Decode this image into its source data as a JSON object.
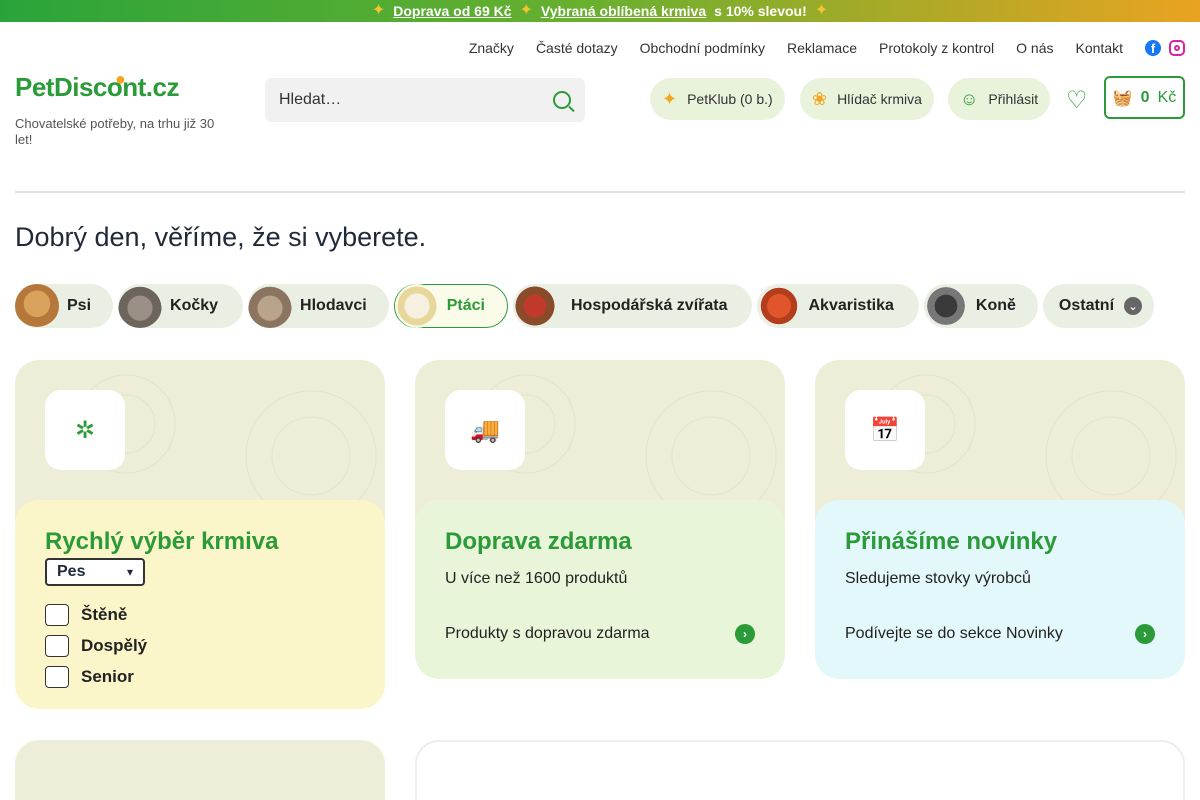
{
  "promo": {
    "part1": "Doprava od 69 Kč",
    "part2": "Vybraná oblíbená krmiva",
    "part3": "s 10% slevou!"
  },
  "topnav": [
    "Značky",
    "Časté dotazy",
    "Obchodní podmínky",
    "Reklamace",
    "Protokoly z kontrol",
    "O nás",
    "Kontakt"
  ],
  "logo": {
    "text": "PetDiscont.cz",
    "tagline": "Chovatelské potřeby, na trhu již 30 let!"
  },
  "search": {
    "placeholder": "Hledat…"
  },
  "header_buttons": {
    "petklub": "PetKlub (0 b.)",
    "hlidac": "Hlídač krmiva",
    "login": "Přihlásit"
  },
  "cart": {
    "amount": "0",
    "currency": "Kč"
  },
  "greeting": "Dobrý den, věříme, že si vyberete.",
  "categories": [
    "Psi",
    "Kočky",
    "Hlodavci",
    "Ptáci",
    "Hospodářská zvířata",
    "Akvaristika",
    "Koně",
    "Ostatní"
  ],
  "cards": {
    "quick": {
      "title": "Rychlý výběr krmiva",
      "select": "Pes",
      "options": [
        "Štěně",
        "Dospělý",
        "Senior"
      ]
    },
    "shipping": {
      "title": "Doprava zdarma",
      "sub": "U více než 1600 produktů",
      "link": "Produkty s dopravou zdarma"
    },
    "news": {
      "title": "Přinášíme novinky",
      "sub": "Sledujeme stovky výrobců",
      "link": "Podívejte se do sekce Novinky"
    }
  },
  "colors": {
    "brand_green": "#2b9a38",
    "accent_orange": "#f4a41d"
  }
}
